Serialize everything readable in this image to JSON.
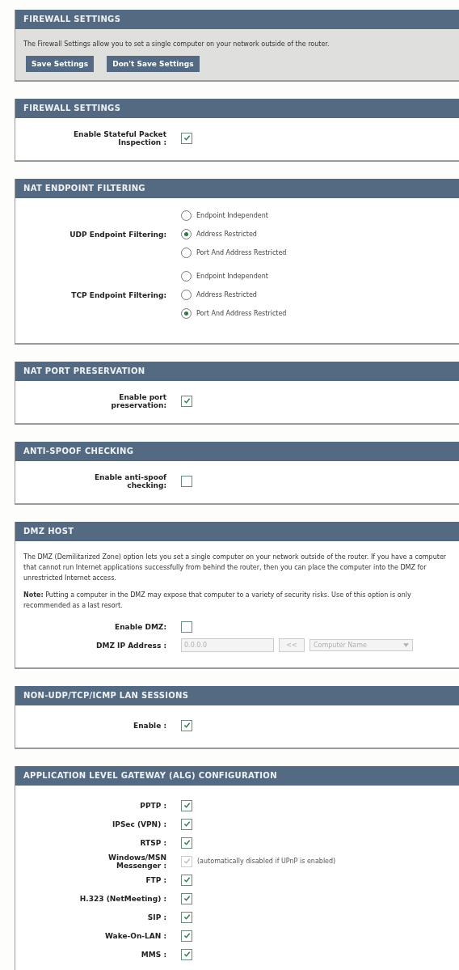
{
  "sections": [
    {
      "title": "FIREWALL SETTINGS",
      "kind": "intro",
      "rows": [
        {
          "kind": "text",
          "text": "The Firewall Settings allow you to set a single computer on your network outside of the router."
        },
        {
          "kind": "buttons",
          "buttons": [
            "Save Settings",
            "Don't Save Settings"
          ]
        }
      ]
    },
    {
      "title": "FIREWALL SETTINGS",
      "kind": "form",
      "rows": [
        {
          "kind": "checkbox",
          "label": "Enable Stateful Packet Inspection :",
          "checked": true,
          "disabled": false
        }
      ]
    },
    {
      "title": "NAT ENDPOINT FILTERING",
      "kind": "form",
      "rows": [
        {
          "kind": "radio-group",
          "label": "UDP Endpoint Filtering:",
          "options": [
            {
              "label": "Endpoint Independent",
              "selected": false
            },
            {
              "label": "Address Restricted",
              "selected": true
            },
            {
              "label": "Port And Address Restricted",
              "selected": false
            }
          ]
        },
        {
          "kind": "radio-group",
          "label": "TCP Endpoint Filtering:",
          "options": [
            {
              "label": "Endpoint Independent",
              "selected": false
            },
            {
              "label": "Address Restricted",
              "selected": false
            },
            {
              "label": "Port And Address Restricted",
              "selected": true
            }
          ]
        }
      ]
    },
    {
      "title": "NAT PORT PRESERVATION",
      "kind": "form",
      "rows": [
        {
          "kind": "checkbox",
          "label": "Enable port preservation:",
          "checked": true,
          "disabled": false
        }
      ]
    },
    {
      "title": "ANTI-SPOOF CHECKING",
      "kind": "form",
      "rows": [
        {
          "kind": "checkbox",
          "label": "Enable anti-spoof checking:",
          "checked": false,
          "disabled": false
        }
      ]
    },
    {
      "title": "DMZ HOST",
      "kind": "form",
      "rows": [
        {
          "kind": "text",
          "text": "The DMZ (Demilitarized Zone) option lets you set a single computer on your network outside of the router. If you have a computer that cannot run Internet applications successfully from behind the router, then you can place the computer into the DMZ for unrestricted Internet access."
        },
        {
          "kind": "text",
          "text": "**Note:** Putting a computer in the DMZ may expose that computer to a variety of security risks. Use of this option is only recommended as a last resort."
        },
        {
          "kind": "checkbox",
          "label": "Enable DMZ:",
          "checked": false,
          "disabled": false
        },
        {
          "kind": "address",
          "label": "DMZ IP Address :",
          "value": "0.0.0.0",
          "button": "<<",
          "select": "Computer Name",
          "disabled": true
        }
      ]
    },
    {
      "title": "NON-UDP/TCP/ICMP LAN SESSIONS",
      "kind": "form",
      "rows": [
        {
          "kind": "checkbox",
          "label": "Enable :",
          "checked": true,
          "disabled": false
        }
      ]
    },
    {
      "title": "APPLICATION LEVEL GATEWAY (ALG) CONFIGURATION",
      "kind": "form",
      "rows": [
        {
          "kind": "checkbox",
          "label": "PPTP :",
          "checked": true,
          "disabled": false
        },
        {
          "kind": "checkbox",
          "label": "IPSec (VPN) :",
          "checked": true,
          "disabled": false
        },
        {
          "kind": "checkbox",
          "label": "RTSP :",
          "checked": true,
          "disabled": false
        },
        {
          "kind": "checkbox",
          "label": "Windows/MSN Messenger :",
          "checked": true,
          "disabled": true,
          "hint": "(automatically disabled if UPnP is enabled)"
        },
        {
          "kind": "checkbox",
          "label": "FTP :",
          "checked": true,
          "disabled": false
        },
        {
          "kind": "checkbox",
          "label": "H.323 (NetMeeting) :",
          "checked": true,
          "disabled": false
        },
        {
          "kind": "checkbox",
          "label": "SIP :",
          "checked": true,
          "disabled": false
        },
        {
          "kind": "checkbox",
          "label": "Wake-On-LAN :",
          "checked": true,
          "disabled": false
        },
        {
          "kind": "checkbox",
          "label": "MMS :",
          "checked": true,
          "disabled": false
        }
      ]
    }
  ]
}
